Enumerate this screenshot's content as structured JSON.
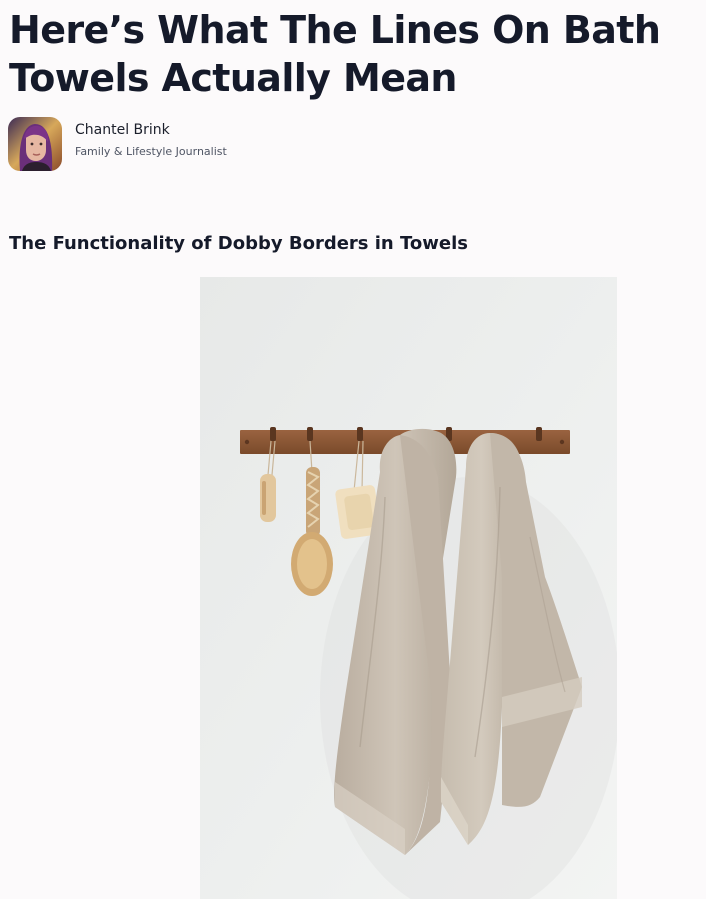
{
  "article": {
    "title": "Here’s What The Lines On Bath Towels Actually Mean",
    "section_heading": "The Functionality of Dobby Borders in Towels"
  },
  "author": {
    "name": "Chantel Brink",
    "role": "Family & Lifestyle Journalist",
    "avatar_icon": "author-portrait"
  },
  "hero_image": {
    "subject": "linen-towels-on-wooden-peg-rack",
    "colors": {
      "wall": "#e9ebe9",
      "rack": "#8a5532",
      "towel": "#cabfb2",
      "brush": "#d9b98a"
    }
  },
  "colors": {
    "background": "#fcfafb",
    "text": "#151a2a",
    "muted": "#4f5564"
  }
}
